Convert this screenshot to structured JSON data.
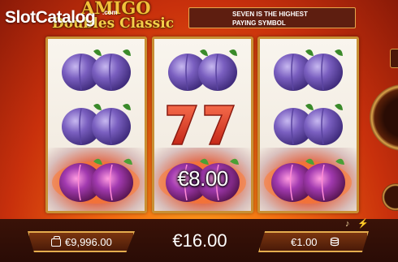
{
  "watermark": {
    "text": "SlotCatalog",
    "sub": ".com"
  },
  "logo": {
    "line1": "AMIGO",
    "line2": "Doubles Classic"
  },
  "banner": {
    "line1": "SEVEN IS THE HIGHEST",
    "line2": "PAYING SYMBOL"
  },
  "reels": [
    {
      "symbols": [
        "plum",
        "plum",
        "plum-fire"
      ]
    },
    {
      "symbols": [
        "plum",
        "seven",
        "plum-fire"
      ],
      "win_label": "€8.00"
    },
    {
      "symbols": [
        "plum",
        "plum",
        "plum-fire"
      ]
    }
  ],
  "footer": {
    "balance": "€9,996.00",
    "win": "€16.00",
    "bet": "€1.00"
  },
  "icons": {
    "balance": "wallet-icon",
    "bet": "coins-icon",
    "sound": "sound-icon",
    "turbo": "lightning-icon"
  },
  "colors": {
    "frame_gold": "#c89034",
    "background_red": "#c8300c",
    "plum_purple": "#7a5fc0",
    "seven_red": "#e04830"
  }
}
